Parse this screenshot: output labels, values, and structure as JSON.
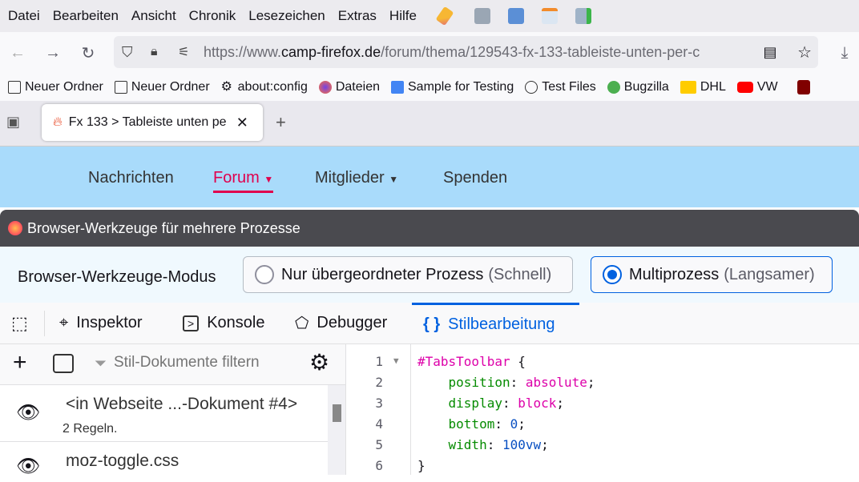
{
  "menu": [
    "Datei",
    "Bearbeiten",
    "Ansicht",
    "Chronik",
    "Lesezeichen",
    "Extras",
    "Hilfe"
  ],
  "menu_icons": [
    "pencil-icon",
    "stats-icon",
    "w3c-validator-icon",
    "calendar-icon",
    "screenshot-add-icon"
  ],
  "url": {
    "prefix": "https://www.",
    "host": "camp-firefox.de",
    "path": "/forum/thema/129543-fx-133-tableiste-unten-per-c"
  },
  "bookmarks": [
    {
      "label": "Neuer Ordner",
      "icon": "folder-icon"
    },
    {
      "label": "Neuer Ordner",
      "icon": "folder-icon"
    },
    {
      "label": "about:config",
      "icon": "gear-icon"
    },
    {
      "label": "Dateien",
      "icon": "firefox-icon"
    },
    {
      "label": "Sample for Testing",
      "icon": "document-icon"
    },
    {
      "label": "Test Files",
      "icon": "globe-icon"
    },
    {
      "label": "Bugzilla",
      "icon": "bugzilla-icon"
    },
    {
      "label": "DHL",
      "icon": "dhl-icon"
    },
    {
      "label": "VW",
      "icon": "youtube-icon"
    }
  ],
  "tab": {
    "title": "Fx 133 > Tableiste unten pe"
  },
  "site_nav": [
    {
      "label": "Nachrichten"
    },
    {
      "label": "Forum",
      "active": true
    },
    {
      "label": "Mitglieder"
    },
    {
      "label": "Spenden"
    }
  ],
  "devtools": {
    "title": "Browser-Werkzeuge für mehrere Prozesse",
    "mode_label": "Browser-Werkzeuge-Modus",
    "opt1": {
      "label": "Nur übergeordneter Prozess",
      "sub": "(Schnell)",
      "selected": false
    },
    "opt2": {
      "label": "Multiprozess",
      "sub": "(Langsamer)",
      "selected": true
    },
    "tabs": [
      "Inspektor",
      "Konsole",
      "Debugger",
      "Stilbearbeitung"
    ],
    "active_tab": "Stilbearbeitung",
    "filter_placeholder": "Stil-Dokumente filtern",
    "sheets": [
      {
        "name": "<in Webseite ...-Dokument #4>",
        "rules": "2 Regeln."
      },
      {
        "name": "moz-toggle.css"
      }
    ],
    "lines": [
      "1",
      "2",
      "3",
      "4",
      "5",
      "6"
    ],
    "code": {
      "selector": "#TabsToolbar",
      "props": [
        [
          "position",
          "absolute"
        ],
        [
          "display",
          "block"
        ],
        [
          "bottom",
          "0"
        ],
        [
          "width",
          "100vw"
        ]
      ]
    }
  },
  "colors": {
    "accent": "#0061e0",
    "site_bg": "#a9dbfb",
    "forum_active": "#e0004d"
  }
}
